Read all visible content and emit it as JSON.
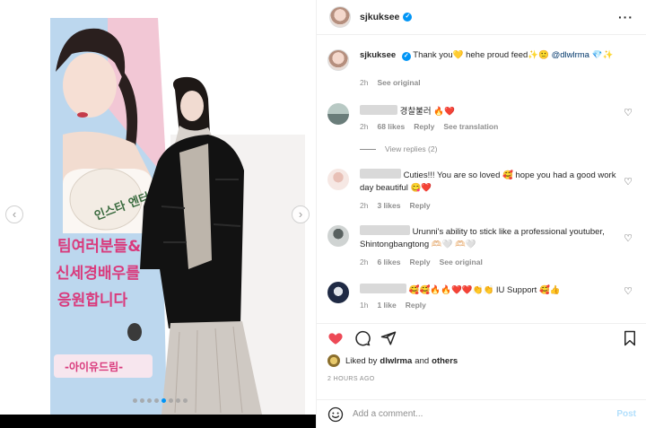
{
  "media": {
    "banner_korean_line1": "팀여러분들&",
    "banner_korean_line2": "신세경배우를",
    "banner_korean_line3": "응원합니다",
    "banner_footer": "-아이유드림-",
    "banner_logo": "인스타 엔터",
    "carousel_dots": 8,
    "active_dot_index": 4
  },
  "post": {
    "username": "sjkuksee",
    "more_icon": "more-horizontal-icon",
    "caption_user": "sjkuksee",
    "caption_text": "Thank you💛 hehe proud feed✨🙂",
    "caption_mention": "@dlwlrma",
    "caption_emoji_tail": "💎✨",
    "caption_time": "2h",
    "caption_see_original": "See original"
  },
  "comments": [
    {
      "text": "경찰불러 🔥❤️",
      "time": "2h",
      "likes": "68 likes",
      "reply": "Reply",
      "extra": "See translation",
      "view_replies": "View replies (2)"
    },
    {
      "text": "Cuties!!! You are so loved 🥰 hope you had a good work day beautiful 😋❤️",
      "time": "2h",
      "likes": "3 likes",
      "reply": "Reply"
    },
    {
      "text": "Urunni's ability to stick like a professional youtuber, Shintongbangtong 🫶🏻🤍 🫶🏻🤍",
      "time": "2h",
      "likes": "6 likes",
      "reply": "Reply",
      "extra": "See original"
    },
    {
      "text": "🥰🥰🔥🔥❤️❤️👏👏 IU Support 🥰👍",
      "time": "1h",
      "likes": "1 like",
      "reply": "Reply"
    }
  ],
  "actions": {
    "like_icon": "heart-filled-icon",
    "comment_icon": "comment-icon",
    "share_icon": "share-icon",
    "save_icon": "bookmark-icon",
    "liked_by_prefix": "Liked by",
    "liked_by_user": "dlwlrma",
    "liked_by_and": "and",
    "liked_by_others": "others",
    "time_ago": "2 HOURS AGO"
  },
  "composer": {
    "emoji_icon": "smiley-icon",
    "placeholder": "Add a comment...",
    "post_label": "Post"
  },
  "colors": {
    "accent": "#0095f6",
    "like_red": "#ed4956",
    "muted": "#8e8e8e"
  }
}
